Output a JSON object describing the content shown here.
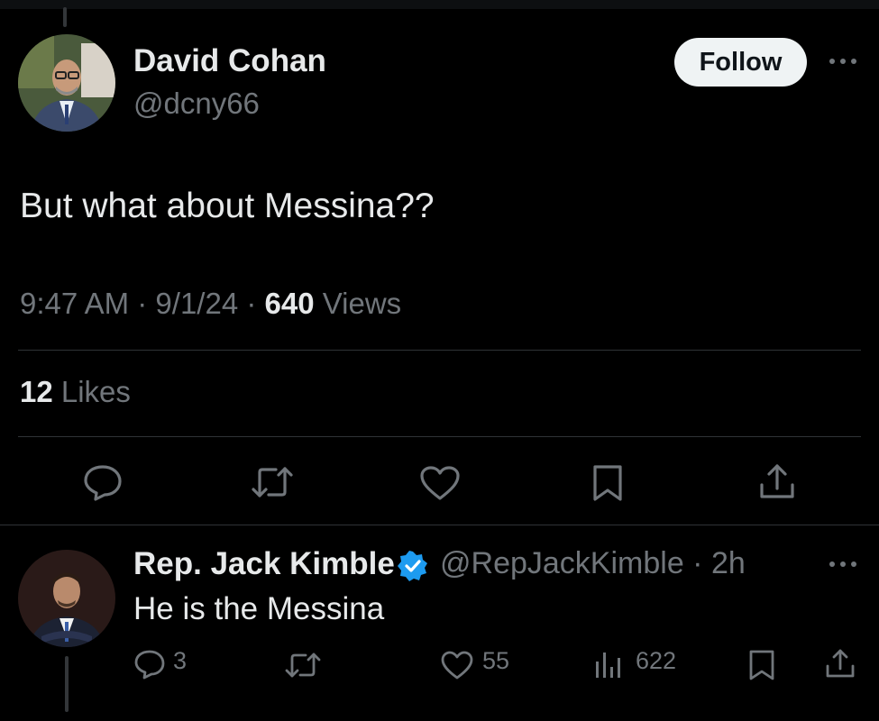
{
  "tweet": {
    "author_name": "David Cohan",
    "author_handle": "@dcny66",
    "follow_label": "Follow",
    "text": "But what about Messina??",
    "time": "9:47 AM",
    "date": "9/1/24",
    "separator": "·",
    "views_count": "640",
    "views_label": "Views",
    "likes_count": "12",
    "likes_label": "Likes",
    "actions": [
      "reply-icon",
      "retweet-icon",
      "like-icon",
      "bookmark-icon",
      "share-icon"
    ]
  },
  "reply": {
    "author_name": "Rep. Jack Kimble",
    "verified": true,
    "author_handle": "@RepJackKimble",
    "separator": "·",
    "time_ago": "2h",
    "text": "He is the Messina",
    "reply_count": "3",
    "retweet_count": "",
    "like_count": "55",
    "view_count": "622"
  },
  "colors": {
    "background": "#000000",
    "primary_text": "#e7e9ea",
    "secondary_text": "#71767b",
    "divider": "#2f3336",
    "verified_blue": "#1d9bf0",
    "follow_button_bg": "#eff3f4"
  }
}
